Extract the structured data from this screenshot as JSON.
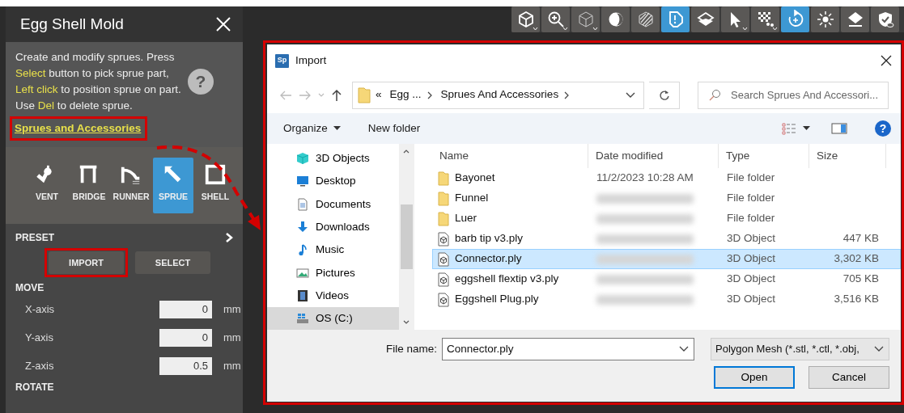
{
  "panel": {
    "title": "Egg Shell Mold",
    "description": "Create and modify sprues. Press **Select** button to pick sprue part, **Left click** to position sprue on part. Use **Del** to delete sprue.",
    "help": "?",
    "link": {
      "label": "Sprues and Accessories",
      "highlighted": true
    },
    "tools": [
      {
        "kind": "vent",
        "label": "VENT",
        "selected": false
      },
      {
        "kind": "bridge",
        "label": "BRIDGE",
        "selected": false
      },
      {
        "kind": "runner",
        "label": "RUNNER",
        "selected": false
      },
      {
        "kind": "sprue",
        "label": "SPRUE",
        "selected": true
      },
      {
        "kind": "shell",
        "label": "SHELL",
        "selected": false
      }
    ],
    "preset": {
      "label": "PRESET",
      "buttons": [
        {
          "label": "IMPORT",
          "highlighted": true
        },
        {
          "label": "SELECT",
          "highlighted": false
        }
      ]
    },
    "move": {
      "label": "MOVE",
      "fields": [
        {
          "label": "X-axis",
          "value": "0",
          "unit": "mm"
        },
        {
          "label": "Y-axis",
          "value": "0",
          "unit": "mm"
        },
        {
          "label": "Z-axis",
          "value": "0.5",
          "unit": "mm"
        }
      ]
    },
    "rotate": {
      "label": "ROTATE"
    }
  },
  "toolbar": [
    {
      "kind": "cube",
      "selected": false,
      "menu": true
    },
    {
      "kind": "zoom",
      "selected": false,
      "menu": true
    },
    {
      "kind": "wire",
      "selected": false,
      "menu": true
    },
    {
      "kind": "shade",
      "selected": false,
      "menu": false
    },
    {
      "kind": "hatch",
      "selected": false,
      "menu": false
    },
    {
      "kind": "alert",
      "selected": true,
      "menu": false
    },
    {
      "kind": "section",
      "selected": false,
      "menu": false
    },
    {
      "kind": "pointer",
      "selected": false,
      "menu": true
    },
    {
      "kind": "checker",
      "selected": false,
      "menu": true
    },
    {
      "kind": "rotate",
      "selected": true,
      "menu": false
    },
    {
      "kind": "sun",
      "selected": false,
      "menu": false
    },
    {
      "kind": "layer",
      "selected": false,
      "menu": false
    },
    {
      "kind": "shield",
      "selected": false,
      "menu": false
    }
  ],
  "dialog": {
    "highlighted": true,
    "app_icon": "Sp",
    "title": "Import",
    "address": {
      "prefix": "«",
      "crumbs": [
        "Egg ...",
        "Sprues And Accessories"
      ]
    },
    "search": {
      "placeholder": "Search Sprues And Accessori..."
    },
    "commands": [
      {
        "label": "Organize",
        "menu": true
      },
      {
        "label": "New folder",
        "menu": false
      }
    ],
    "help": "?",
    "nav_items": [
      {
        "kind": "objects",
        "label": "3D Objects",
        "selected": false
      },
      {
        "kind": "desktop",
        "label": "Desktop",
        "selected": false
      },
      {
        "kind": "documents",
        "label": "Documents",
        "selected": false
      },
      {
        "kind": "downloads",
        "label": "Downloads",
        "selected": false
      },
      {
        "kind": "music",
        "label": "Music",
        "selected": false
      },
      {
        "kind": "pictures",
        "label": "Pictures",
        "selected": false
      },
      {
        "kind": "videos",
        "label": "Videos",
        "selected": false
      },
      {
        "kind": "drive",
        "label": "OS (C:)",
        "selected": true
      }
    ],
    "columns": [
      "Name",
      "Date modified",
      "Type",
      "Size"
    ],
    "rows": [
      {
        "kind": "folder",
        "name": "Bayonet",
        "date": "11/2/2023 10:28 AM",
        "type": "File folder",
        "selected": false
      },
      {
        "kind": "folder",
        "name": "Funnel",
        "type": "File folder",
        "selected": false
      },
      {
        "kind": "folder",
        "name": "Luer",
        "type": "File folder",
        "selected": false
      },
      {
        "kind": "object",
        "name": "barb tip v3.ply",
        "type": "3D Object",
        "size": "447 KB",
        "selected": false
      },
      {
        "kind": "object",
        "name": "Connector.ply",
        "type": "3D Object",
        "size": "3,302 KB",
        "selected": true
      },
      {
        "kind": "object",
        "name": "eggshell flextip v3.ply",
        "type": "3D Object",
        "size": "705 KB",
        "selected": false
      },
      {
        "kind": "object",
        "name": "Eggshell Plug.ply",
        "type": "3D Object",
        "size": "3,516 KB",
        "selected": false
      }
    ],
    "file_name": {
      "label": "File name:",
      "value": "Connector.ply"
    },
    "filter": "Polygon Mesh (*.stl, *.ctl, *.obj,",
    "buttons": [
      {
        "label": "Open",
        "default": true
      },
      {
        "label": "Cancel",
        "default": false
      }
    ]
  }
}
